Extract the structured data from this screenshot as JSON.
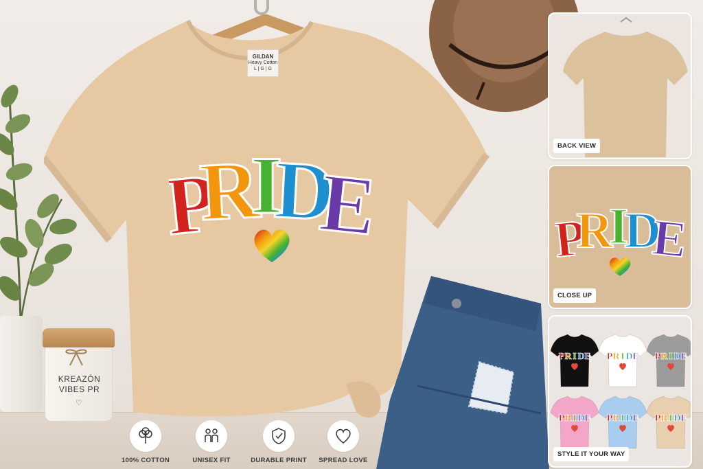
{
  "product": {
    "tag_brand": "GILDAN",
    "tag_sub": "Heavy Cotton",
    "tag_size": "L | G | G",
    "print_text": "PRIDE",
    "print_colors": [
      "#d2231f",
      "#f2960d",
      "#46b22f",
      "#1e8fcf",
      "#6a3aa8"
    ],
    "shirt_color": "#e6c9a3"
  },
  "candle": {
    "line1": "KREAZÓN",
    "line2": "VIBES PR",
    "heart": "♡"
  },
  "features": [
    {
      "icon": "cotton-icon",
      "label": "100% COTTON"
    },
    {
      "icon": "unisex-icon",
      "label": "UNISEX FIT"
    },
    {
      "icon": "shield-check-icon",
      "label": "DURABLE PRINT"
    },
    {
      "icon": "heart-icon",
      "label": "SPREAD LOVE"
    }
  ],
  "panels": {
    "back": {
      "label": "BACK VIEW"
    },
    "close": {
      "label": "CLOSE UP",
      "print_text": "PRIDE"
    },
    "style": {
      "label": "STYLE IT YOUR WAY",
      "variants": [
        {
          "color": "#111111",
          "print_text": "PRIDE"
        },
        {
          "color": "#ffffff",
          "print_text": "PRIDE"
        },
        {
          "color": "#9c9c9c",
          "print_text": "PRIDE"
        },
        {
          "color": "#f3a6c8",
          "print_text": "PRIDE"
        },
        {
          "color": "#a9cdef",
          "print_text": "PRIDE"
        },
        {
          "color": "#e7cfb0",
          "print_text": "PRIDE"
        }
      ]
    }
  }
}
